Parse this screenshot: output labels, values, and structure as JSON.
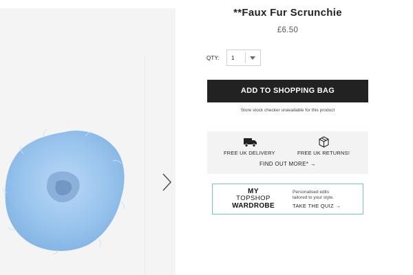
{
  "product": {
    "title": "**Faux Fur Scrunchie",
    "price": "£6.50"
  },
  "quantity": {
    "label": "QTY:",
    "selected": "1"
  },
  "actions": {
    "add_to_bag": "ADD TO SHOPPING BAG",
    "stock_note": "Store stock checker unavailable for this product"
  },
  "delivery": {
    "free_delivery": "FREE UK DELIVERY",
    "free_returns": "FREE UK RETURNS!",
    "find_out_more": "FIND OUT MORE* →"
  },
  "wardrobe": {
    "logo_line1": "MY",
    "logo_line2": "TOPSHOP",
    "logo_line3": "WARDROBE",
    "promo_line1": "Personalised edits",
    "promo_line2": "tailored to your style.",
    "quiz_link": "TAKE THE QUIZ →"
  },
  "gallery": {
    "image_icon": "faux-fur-scrunchie",
    "next_icon": "chevron-right-icon"
  },
  "colors": {
    "button_bg": "#222222",
    "wardrobe_border": "#6fc7b2",
    "scrunchie_blue": "#9cc6ee",
    "panel_bg": "#f3f3f3"
  }
}
